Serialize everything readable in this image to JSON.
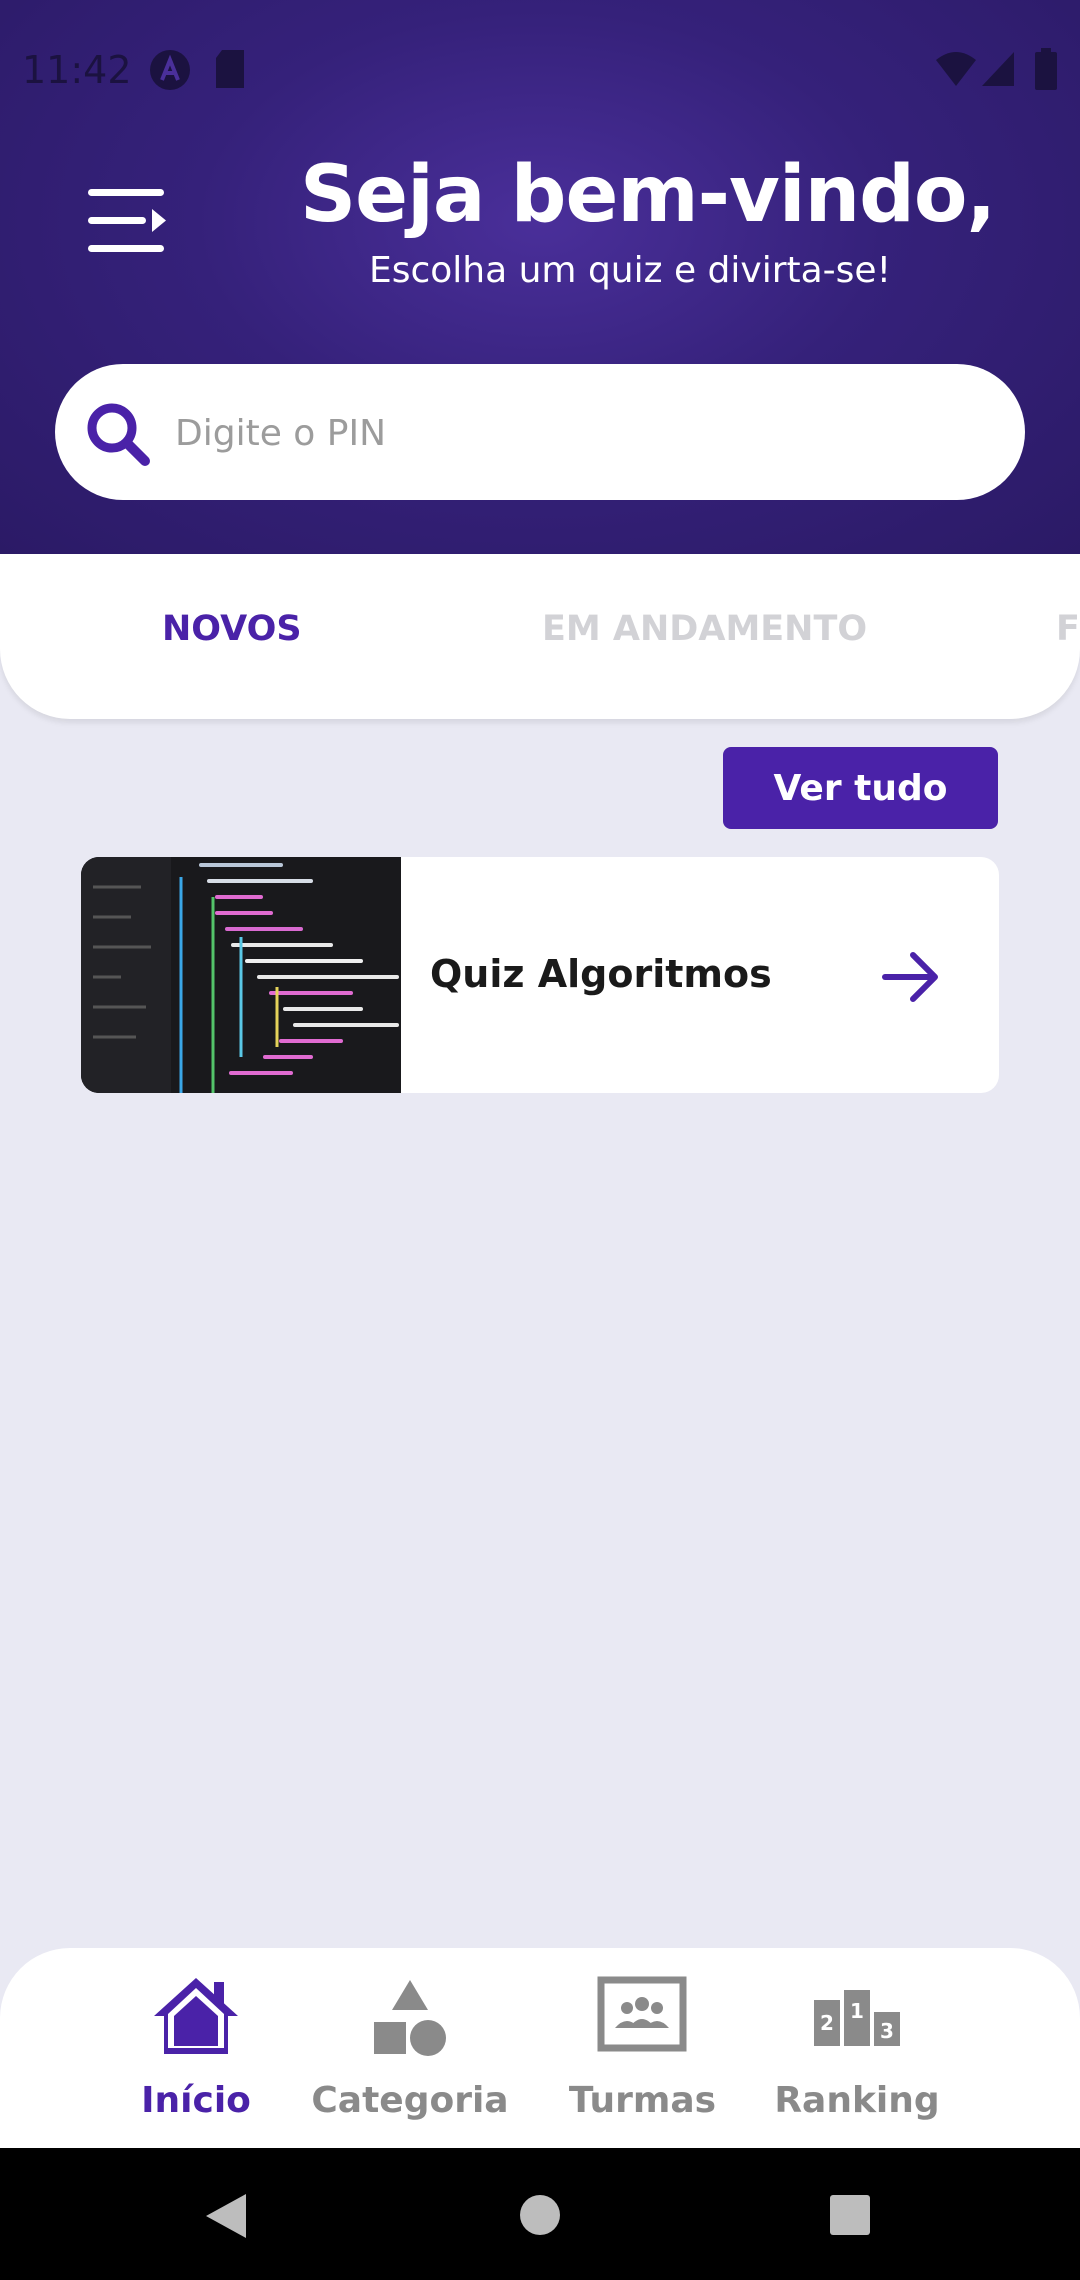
{
  "status_bar": {
    "time": "11:42"
  },
  "header": {
    "title": "Seja bem-vindo,",
    "subtitle": "Escolha um quiz e divirta-se!"
  },
  "search": {
    "placeholder": "Digite o PIN",
    "value": ""
  },
  "tabs": [
    {
      "label": "NOVOS",
      "active": true
    },
    {
      "label": "EM ANDAMENTO",
      "active": false
    },
    {
      "label": "F",
      "active": false
    }
  ],
  "see_all_label": "Ver tudo",
  "quiz_list": [
    {
      "title": "Quiz Algoritmos"
    }
  ],
  "bottom_nav": [
    {
      "label": "Início",
      "icon": "home-icon",
      "active": true
    },
    {
      "label": "Categoria",
      "icon": "shapes-icon",
      "active": false
    },
    {
      "label": "Turmas",
      "icon": "classroom-icon",
      "active": false
    },
    {
      "label": "Ranking",
      "icon": "podium-icon",
      "active": false
    }
  ],
  "colors": {
    "primary": "#4a22a8",
    "header_dark": "#2b1a66",
    "background": "#e9e9f3",
    "inactive": "#8a8a8a"
  }
}
